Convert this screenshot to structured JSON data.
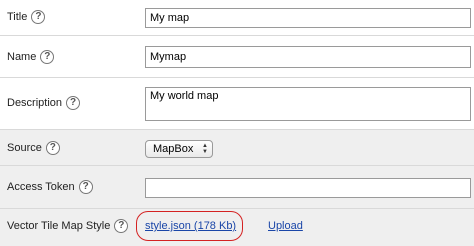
{
  "fields": {
    "title": {
      "label": "Title",
      "value": "My map"
    },
    "name": {
      "label": "Name",
      "value": "Mymap"
    },
    "description": {
      "label": "Description",
      "value": "My world map"
    },
    "source": {
      "label": "Source",
      "selected": "MapBox"
    },
    "access_token": {
      "label": "Access Token",
      "value": ""
    },
    "vector_tile_map_style": {
      "label": "Vector Tile Map Style",
      "file_link": "style.json (178 Kb)",
      "upload_link": "Upload"
    }
  },
  "help_glyph": "?",
  "colors": {
    "link": "#1a46a8",
    "highlight_ring": "#d42222",
    "grey_row": "#efefef"
  }
}
